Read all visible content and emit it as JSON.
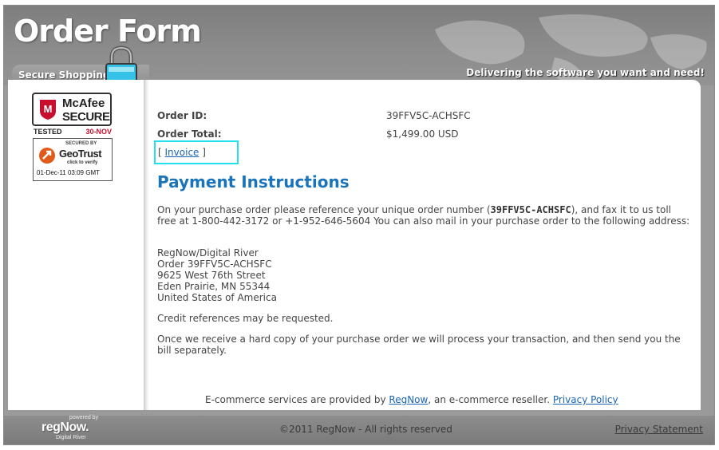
{
  "header": {
    "title": "Order Form",
    "tagline": "Delivering the software you want and need!",
    "secure_label": "Secure Shopping"
  },
  "badges": {
    "mcafee_brand": "McAfee",
    "mcafee_secure": "SECURE",
    "mcafee_tested": "TESTED",
    "mcafee_date": "30-NOV",
    "geotrust_secured": "SECURED BY",
    "geotrust_name": "GeoTrust",
    "geotrust_click": "click to verify",
    "geotrust_date": "01-Dec-11 03:09 GMT"
  },
  "order": {
    "id_label": "Order ID:",
    "id_value": "39FFV5C-ACHSFC",
    "total_label": "Order Total:",
    "total_value": "$1,499.00 USD",
    "invoice_open": "[",
    "invoice_link": "Invoice",
    "invoice_close": "]"
  },
  "instructions": {
    "heading": "Payment Instructions",
    "intro_pre": "On your purchase order please reference your unique order number (",
    "intro_order": "39FFV5C-ACHSFC",
    "intro_post": "), and fax it to us toll free at 1-800-442-3172 or +1-952-646-5604 You can also mail in your purchase order to the following address:",
    "address": [
      "RegNow/Digital River",
      "Order 39FFV5C-ACHSFC",
      "9625 West 76th Street",
      "Eden Prairie, MN 55344",
      "United States of America"
    ],
    "credit_refs": "Credit references may be requested.",
    "hard_copy": "Once we receive a hard copy of your purchase order we will process your transaction, and then send you the bill separately."
  },
  "services": {
    "prefix": "E-commerce services are provided by",
    "regnow_link": "RegNow",
    "middle": ", an e-commerce reseller.",
    "privacy_link": "Privacy Policy"
  },
  "footer": {
    "powered_by": "powered by",
    "logo": "regNow.",
    "digital_river": "Digital River",
    "copyright": "©2011 RegNow - All rights reserved",
    "privacy_statement": "Privacy Statement"
  },
  "colors": {
    "heading": "#1a74bc",
    "link": "#1a64b4",
    "highlight": "#22e0f0",
    "chrome_gray": "#8d8d8d"
  }
}
